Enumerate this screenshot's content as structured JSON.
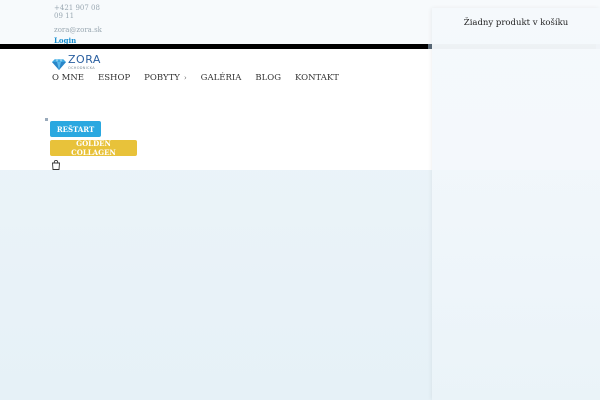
{
  "topbar": {
    "phone_line1": "+421 907 08",
    "phone_line2": "09 11",
    "email": "zora@zora.sk",
    "login_label": "Login"
  },
  "logo": {
    "brand": "ZORA",
    "tagline": "OCHODNICKA"
  },
  "nav": {
    "items": [
      {
        "label": "O MNE"
      },
      {
        "label": "ESHOP"
      },
      {
        "label": "POBYTY"
      },
      {
        "label": "GALÉRIA"
      },
      {
        "label": "BLOG"
      },
      {
        "label": "KONTAKT"
      }
    ]
  },
  "buttons": {
    "restart_label": "REŠTART",
    "golden_label": "GOLDEN COLLAGEN"
  },
  "cart": {
    "empty_text": "Žiadny produkt v košíku"
  },
  "colors": {
    "primary_blue": "#2aa8e0",
    "golden": "#e8c23a",
    "login_blue": "#1a8fd0"
  }
}
